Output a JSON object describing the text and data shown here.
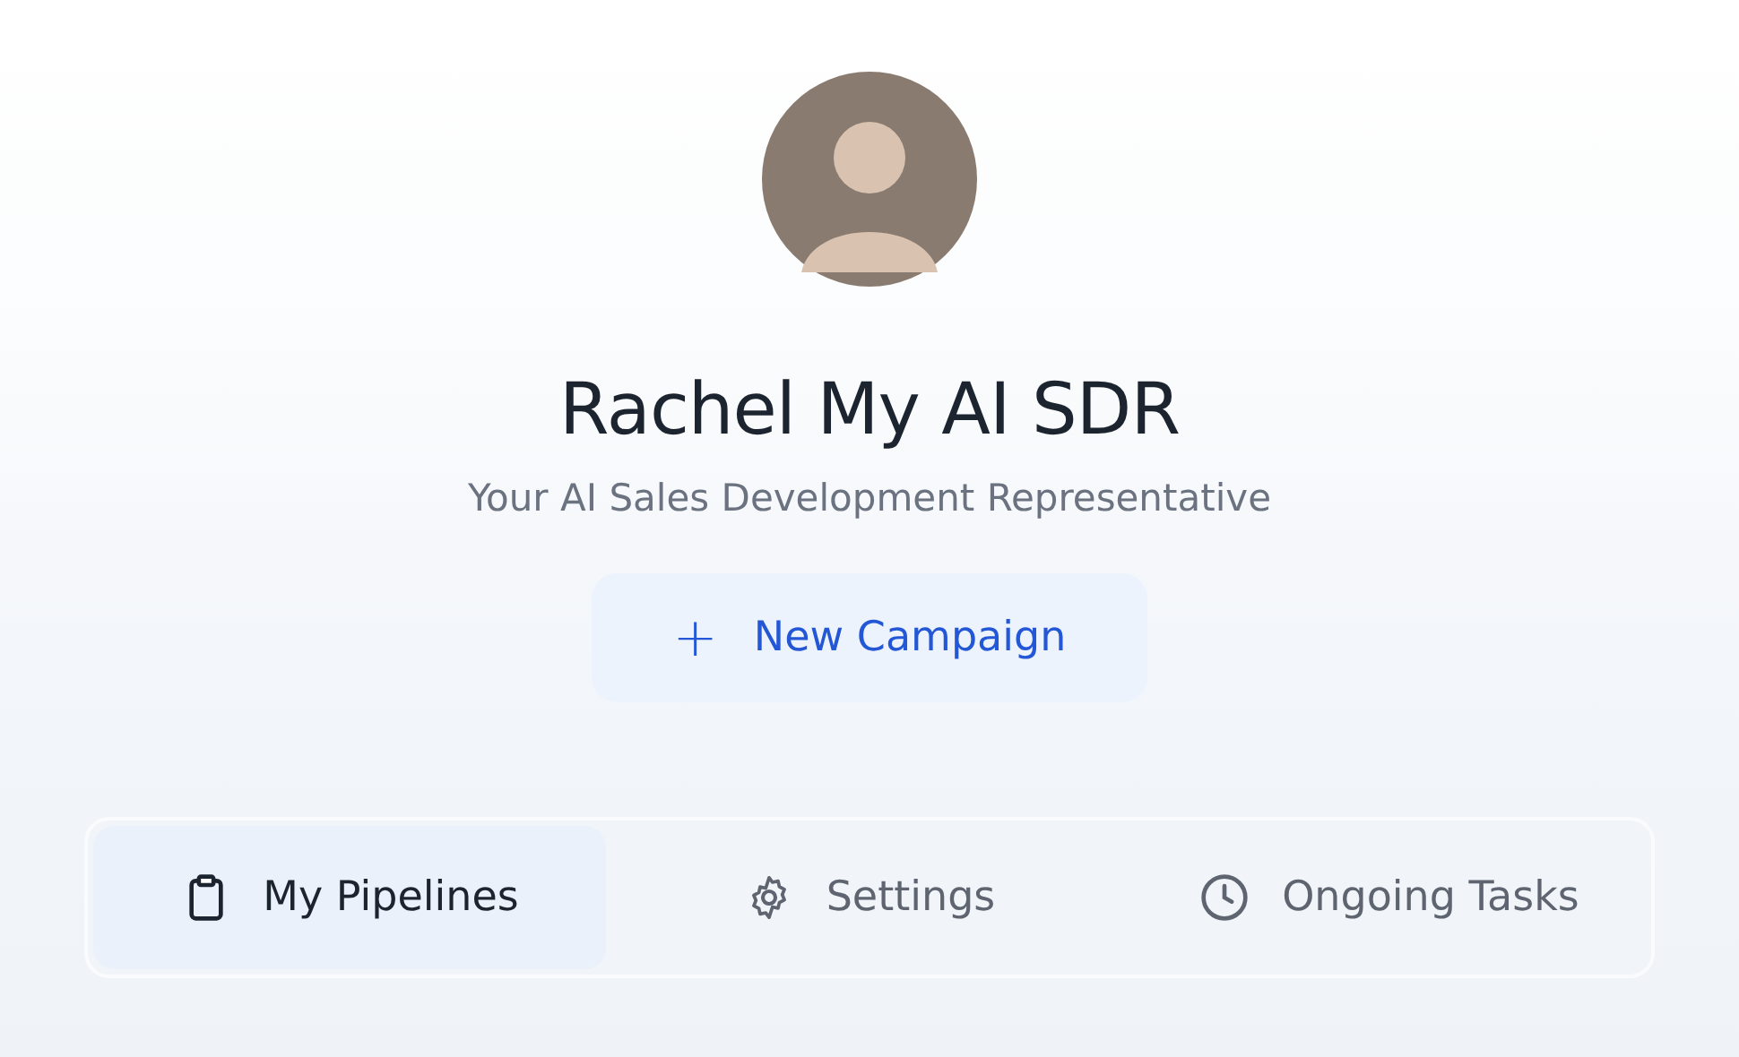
{
  "profile": {
    "name": "Rachel My AI SDR",
    "subtitle": "Your AI Sales Development Representative"
  },
  "new_campaign_button": {
    "icon": "+",
    "label": "New Campaign"
  },
  "tabs": [
    {
      "label": "My Pipelines",
      "selected": true
    },
    {
      "label": "Settings",
      "selected": false
    },
    {
      "label": "Ongoing Tasks",
      "selected": false
    }
  ]
}
